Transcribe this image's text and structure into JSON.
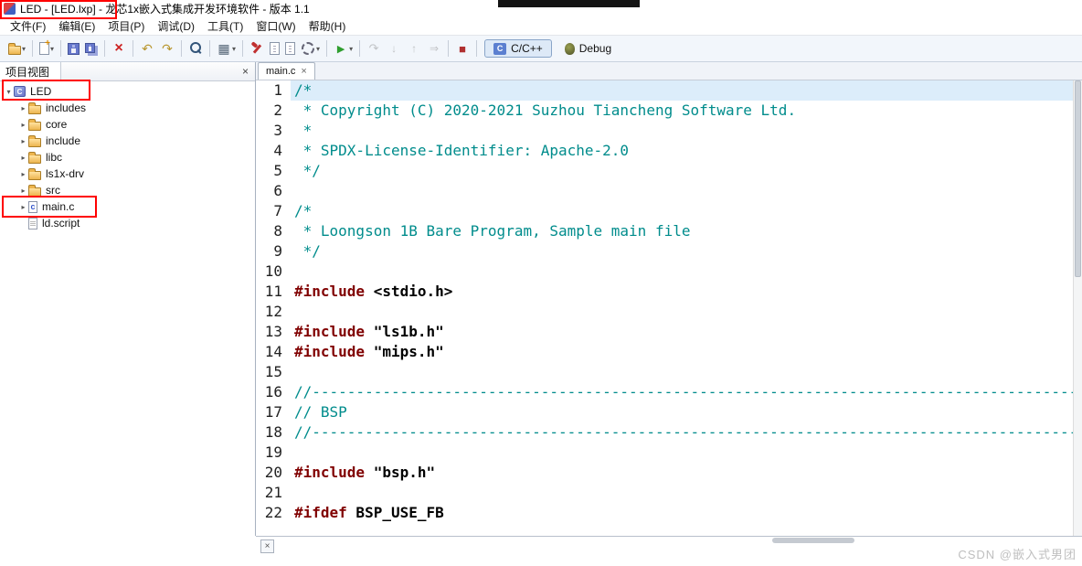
{
  "window": {
    "title": "LED - [LED.lxp] - 龙芯1x嵌入式集成开发环境软件 - 版本 1.1"
  },
  "menu": {
    "items": [
      "文件(F)",
      "编辑(E)",
      "项目(P)",
      "调试(D)",
      "工具(T)",
      "窗口(W)",
      "帮助(H)"
    ]
  },
  "toolbar": {
    "groups": [
      [
        {
          "name": "open-project-button",
          "icon": "folder",
          "dropdown": true
        }
      ],
      [
        {
          "name": "new-button",
          "icon": "page",
          "dropdown": true
        }
      ],
      [
        {
          "name": "save-button",
          "icon": "save"
        },
        {
          "name": "save-all-button",
          "icon": "saveall"
        }
      ],
      [
        {
          "name": "delete-button",
          "icon": "delete"
        }
      ],
      [
        {
          "name": "undo-button",
          "icon": "undo"
        },
        {
          "name": "redo-button",
          "icon": "redo"
        }
      ],
      [
        {
          "name": "search-button",
          "icon": "search"
        }
      ],
      [
        {
          "name": "view-menu-button",
          "icon": "grid",
          "dropdown": true
        }
      ],
      [
        {
          "name": "flash-tool-button",
          "icon": "tool"
        },
        {
          "name": "new-source-file-button",
          "icon": "page2"
        },
        {
          "name": "new-header-file-button",
          "icon": "page2"
        },
        {
          "name": "settings-button",
          "icon": "gear",
          "dropdown": true
        }
      ],
      [
        {
          "name": "run-button",
          "icon": "run",
          "dropdown": true
        }
      ],
      [
        {
          "name": "step-over-button",
          "icon": "stepover",
          "disabled": true
        },
        {
          "name": "step-into-button",
          "icon": "stepinto",
          "disabled": true
        },
        {
          "name": "step-return-button",
          "icon": "stepreturn",
          "disabled": true
        },
        {
          "name": "step-instruction-button",
          "icon": "stepinstr",
          "disabled": true
        }
      ],
      [
        {
          "name": "stop-button",
          "icon": "stop"
        }
      ]
    ],
    "perspectives": [
      {
        "name": "perspective-cpp",
        "label": "C/C++",
        "icon": "cpp",
        "active": true
      },
      {
        "name": "perspective-debug",
        "label": "Debug",
        "icon": "bug",
        "active": false
      }
    ]
  },
  "project_view": {
    "title": "项目视图",
    "close_glyph": "×",
    "tree": [
      {
        "label": "LED",
        "level": 0,
        "icon": "project",
        "arrow": "expanded",
        "highlighted": true
      },
      {
        "label": "includes",
        "level": 1,
        "icon": "includes",
        "arrow": "collapsed",
        "highlighted": false
      },
      {
        "label": "core",
        "level": 1,
        "icon": "folder",
        "arrow": "collapsed",
        "highlighted": false
      },
      {
        "label": "include",
        "level": 1,
        "icon": "folder",
        "arrow": "collapsed",
        "highlighted": false
      },
      {
        "label": "libc",
        "level": 1,
        "icon": "folder",
        "arrow": "collapsed",
        "highlighted": false
      },
      {
        "label": "ls1x-drv",
        "level": 1,
        "icon": "folder",
        "arrow": "collapsed",
        "highlighted": false
      },
      {
        "label": "src",
        "level": 1,
        "icon": "folder",
        "arrow": "collapsed",
        "highlighted": false
      },
      {
        "label": "main.c",
        "level": 1,
        "icon": "cfile",
        "arrow": "collapsed",
        "highlighted": true
      },
      {
        "label": "ld.script",
        "level": 1,
        "icon": "file",
        "arrow": null,
        "highlighted": false
      }
    ]
  },
  "editor": {
    "tab": "main.c",
    "tab_close_glyph": "×",
    "lines": [
      {
        "n": "1",
        "cur": true,
        "seg": [
          [
            "c",
            "/*"
          ]
        ]
      },
      {
        "n": "2",
        "seg": [
          [
            "c",
            " * Copyright (C) 2020-2021 Suzhou Tiancheng Software Ltd."
          ]
        ]
      },
      {
        "n": "3",
        "seg": [
          [
            "c",
            " *"
          ]
        ]
      },
      {
        "n": "4",
        "seg": [
          [
            "c",
            " * SPDX-License-Identifier: Apache-2.0"
          ]
        ]
      },
      {
        "n": "5",
        "seg": [
          [
            "c",
            " */"
          ]
        ]
      },
      {
        "n": "6",
        "seg": []
      },
      {
        "n": "7",
        "seg": [
          [
            "c",
            "/*"
          ]
        ]
      },
      {
        "n": "8",
        "seg": [
          [
            "c",
            " * Loongson 1B Bare Program, Sample main file"
          ]
        ]
      },
      {
        "n": "9",
        "seg": [
          [
            "c",
            " */"
          ]
        ]
      },
      {
        "n": "10",
        "seg": []
      },
      {
        "n": "11",
        "seg": [
          [
            "d",
            "#include"
          ],
          [
            "p",
            " <stdio.h>"
          ]
        ]
      },
      {
        "n": "12",
        "seg": []
      },
      {
        "n": "13",
        "seg": [
          [
            "d",
            "#include"
          ],
          [
            "p",
            " \"ls1b.h\""
          ]
        ]
      },
      {
        "n": "14",
        "seg": [
          [
            "d",
            "#include"
          ],
          [
            "p",
            " \"mips.h\""
          ]
        ]
      },
      {
        "n": "15",
        "seg": []
      },
      {
        "n": "16",
        "seg": [
          [
            "c",
            "//--------------------------------------------------------------------------------------------------------------"
          ]
        ]
      },
      {
        "n": "17",
        "seg": [
          [
            "c",
            "// BSP"
          ]
        ]
      },
      {
        "n": "18",
        "seg": [
          [
            "c",
            "//--------------------------------------------------------------------------------------------------------------"
          ]
        ]
      },
      {
        "n": "19",
        "seg": []
      },
      {
        "n": "20",
        "seg": [
          [
            "d",
            "#include"
          ],
          [
            "p",
            " \"bsp.h\""
          ]
        ]
      },
      {
        "n": "21",
        "seg": []
      },
      {
        "n": "22",
        "seg": [
          [
            "d",
            "#ifdef"
          ],
          [
            "p",
            " BSP_USE_FB"
          ]
        ]
      }
    ]
  },
  "bottom": {
    "close_glyph": "×"
  },
  "watermark": "CSDN @嵌入式男团",
  "annotations": [
    "window-title",
    "tree-item-LED",
    "tree-item-main.c"
  ],
  "colors": {
    "comment": "#008C8C",
    "directive": "#800000",
    "plain": "#000000",
    "annotation": "#FF0000"
  }
}
